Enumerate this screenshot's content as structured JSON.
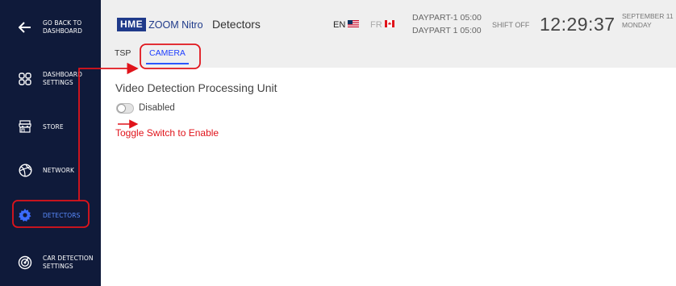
{
  "sidebar": {
    "items": [
      {
        "label": "GO BACK TO\nDASHBOARD",
        "icon": "arrow-left-icon"
      },
      {
        "label": "DASHBOARD\nSETTINGS",
        "icon": "grid-icon"
      },
      {
        "label": "STORE",
        "icon": "store-icon"
      },
      {
        "label": "NETWORK",
        "icon": "network-icon"
      },
      {
        "label": "DETECTORS",
        "icon": "gear-icon",
        "active": true
      },
      {
        "label": "CAR DETECTION\nSETTINGS",
        "icon": "radar-icon"
      }
    ]
  },
  "header": {
    "logo_hme": "HME",
    "logo_zoom": "ZOOM Nitro",
    "title": "Detectors",
    "lang_en": "EN",
    "lang_fr": "FR",
    "daypart_1": "DAYPART-1  05:00",
    "daypart_2": "DAYPART 1  05:00",
    "shift": "SHIFT OFF",
    "clock": "12:29:37",
    "date_1": "SEPTEMBER 11",
    "date_2": "MONDAY",
    "tabs": [
      {
        "label": "TSP"
      },
      {
        "label": "CAMERA",
        "active": true
      }
    ]
  },
  "main": {
    "section_title": "Video Detection Processing Unit",
    "toggle_label": "Disabled",
    "toggle_on": false,
    "hint": "Toggle Switch to Enable"
  },
  "colors": {
    "sidebar_bg": "#0f1a3a",
    "accent_blue": "#2c57ff",
    "annotation_red": "#e0141b",
    "brand_blue": "#1f3a8a"
  }
}
